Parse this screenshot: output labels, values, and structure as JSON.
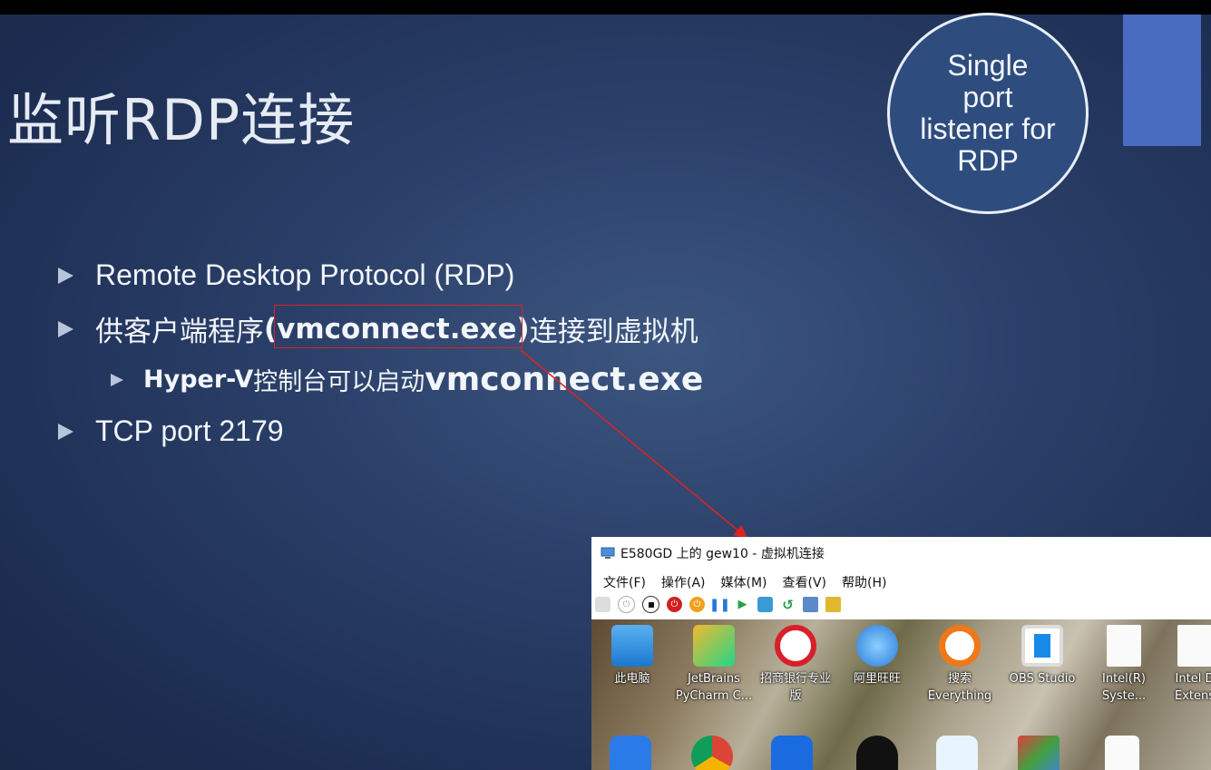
{
  "slide": {
    "title": "监听RDP连接",
    "badge": "Single port listener for RDP",
    "bullets": {
      "b1": "Remote Desktop Protocol (RDP)",
      "b2_pre": "供客户端程序",
      "b2_hl": "(vmconnect.exe)",
      "b2_post": "连接到虚拟机",
      "sub_pre": "Hyper-V",
      "sub_mid": " 控制台可以启动",
      "sub_post": "vmconnect.exe",
      "b3": "TCP port 2179"
    }
  },
  "vm_window": {
    "title": "E580GD 上的 gew10 - 虚拟机连接",
    "menu": [
      "文件(F)",
      "操作(A)",
      "媒体(M)",
      "查看(V)",
      "帮助(H)"
    ],
    "desktop_icons": [
      {
        "label": "此电脑",
        "icon": "computer-icon"
      },
      {
        "label": "JetBrains PyCharm C...",
        "icon": "pycharm-icon"
      },
      {
        "label": "招商银行专业版",
        "icon": "cmb-icon"
      },
      {
        "label": "阿里旺旺",
        "icon": "aliwangwang-icon"
      },
      {
        "label": "搜索 Everything",
        "icon": "everything-icon"
      },
      {
        "label": "OBS Studio",
        "icon": "obs-icon"
      },
      {
        "label": "Intel(R) Syste...",
        "icon": "file-icon"
      },
      {
        "label": "Intel D Extens",
        "icon": "file-icon"
      }
    ]
  }
}
